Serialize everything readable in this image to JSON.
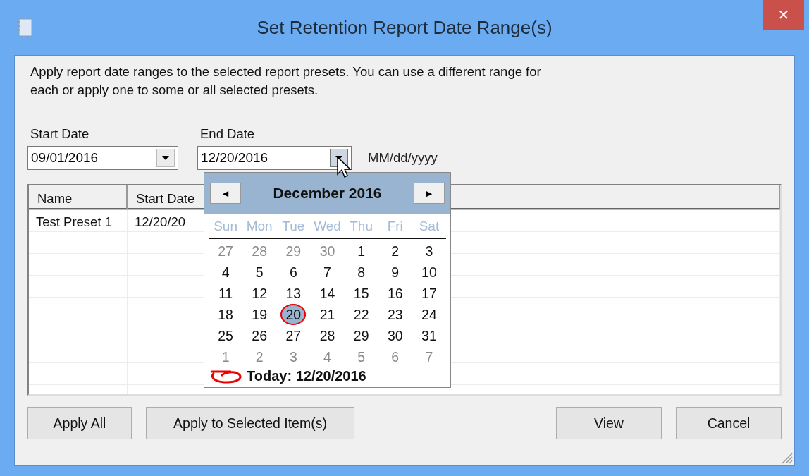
{
  "window": {
    "title": "Set Retention Report Date Range(s)",
    "close": "✕"
  },
  "description": "Apply report date ranges to the selected report presets. You can use a different range for each or apply one to some or all selected presets.",
  "start_date": {
    "label": "Start Date",
    "value": "09/01/2016"
  },
  "end_date": {
    "label": "End Date",
    "value": "12/20/2016",
    "expanded": true
  },
  "format_hint": "MM/dd/yyyy",
  "table": {
    "columns": [
      "Name",
      "Start Date"
    ],
    "rows": [
      [
        "Test Preset 1",
        "12/20/20"
      ]
    ]
  },
  "calendar": {
    "month": "December 2016",
    "prev": "◀",
    "next": "▶",
    "weekdays": [
      "Sun",
      "Mon",
      "Tue",
      "Wed",
      "Thu",
      "Fri",
      "Sat"
    ],
    "days": [
      {
        "label": "27",
        "other_month": true,
        "selected": false,
        "today": false
      },
      {
        "label": "28",
        "other_month": true,
        "selected": false,
        "today": false
      },
      {
        "label": "29",
        "other_month": true,
        "selected": false,
        "today": false
      },
      {
        "label": "30",
        "other_month": true,
        "selected": false,
        "today": false
      },
      {
        "label": "1",
        "other_month": false,
        "selected": false,
        "today": false
      },
      {
        "label": "2",
        "other_month": false,
        "selected": false,
        "today": false
      },
      {
        "label": "3",
        "other_month": false,
        "selected": false,
        "today": false
      },
      {
        "label": "4",
        "other_month": false,
        "selected": false,
        "today": false
      },
      {
        "label": "5",
        "other_month": false,
        "selected": false,
        "today": false
      },
      {
        "label": "6",
        "other_month": false,
        "selected": false,
        "today": false
      },
      {
        "label": "7",
        "other_month": false,
        "selected": false,
        "today": false
      },
      {
        "label": "8",
        "other_month": false,
        "selected": false,
        "today": false
      },
      {
        "label": "9",
        "other_month": false,
        "selected": false,
        "today": false
      },
      {
        "label": "10",
        "other_month": false,
        "selected": false,
        "today": false
      },
      {
        "label": "11",
        "other_month": false,
        "selected": false,
        "today": false
      },
      {
        "label": "12",
        "other_month": false,
        "selected": false,
        "today": false
      },
      {
        "label": "13",
        "other_month": false,
        "selected": false,
        "today": false
      },
      {
        "label": "14",
        "other_month": false,
        "selected": false,
        "today": false
      },
      {
        "label": "15",
        "other_month": false,
        "selected": false,
        "today": false
      },
      {
        "label": "16",
        "other_month": false,
        "selected": false,
        "today": false
      },
      {
        "label": "17",
        "other_month": false,
        "selected": false,
        "today": false
      },
      {
        "label": "18",
        "other_month": false,
        "selected": false,
        "today": false
      },
      {
        "label": "19",
        "other_month": false,
        "selected": false,
        "today": false
      },
      {
        "label": "20",
        "other_month": false,
        "selected": true,
        "today": true
      },
      {
        "label": "21",
        "other_month": false,
        "selected": false,
        "today": false
      },
      {
        "label": "22",
        "other_month": false,
        "selected": false,
        "today": false
      },
      {
        "label": "23",
        "other_month": false,
        "selected": false,
        "today": false
      },
      {
        "label": "24",
        "other_month": false,
        "selected": false,
        "today": false
      },
      {
        "label": "25",
        "other_month": false,
        "selected": false,
        "today": false
      },
      {
        "label": "26",
        "other_month": false,
        "selected": false,
        "today": false
      },
      {
        "label": "27",
        "other_month": false,
        "selected": false,
        "today": false
      },
      {
        "label": "28",
        "other_month": false,
        "selected": false,
        "today": false
      },
      {
        "label": "29",
        "other_month": false,
        "selected": false,
        "today": false
      },
      {
        "label": "30",
        "other_month": false,
        "selected": false,
        "today": false
      },
      {
        "label": "31",
        "other_month": false,
        "selected": false,
        "today": false
      },
      {
        "label": "1",
        "other_month": true,
        "selected": false,
        "today": false
      },
      {
        "label": "2",
        "other_month": true,
        "selected": false,
        "today": false
      },
      {
        "label": "3",
        "other_month": true,
        "selected": false,
        "today": false
      },
      {
        "label": "4",
        "other_month": true,
        "selected": false,
        "today": false
      },
      {
        "label": "5",
        "other_month": true,
        "selected": false,
        "today": false
      },
      {
        "label": "6",
        "other_month": true,
        "selected": false,
        "today": false
      },
      {
        "label": "7",
        "other_month": true,
        "selected": false,
        "today": false
      }
    ],
    "today_label": "Today: 12/20/2016"
  },
  "buttons": {
    "left": [
      "Apply All",
      "Apply to Selected Item(s)"
    ],
    "right": [
      "View",
      "Cancel"
    ]
  }
}
